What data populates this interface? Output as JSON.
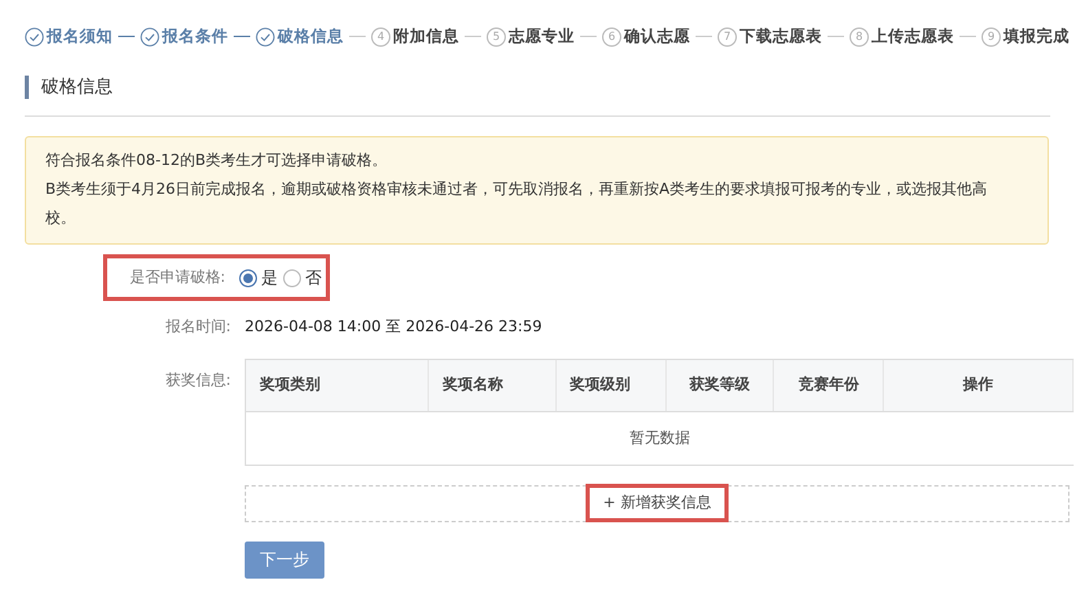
{
  "steps": [
    {
      "label": "报名须知",
      "done": true
    },
    {
      "label": "报名条件",
      "done": true
    },
    {
      "label": "破格信息",
      "done": true
    },
    {
      "number": "4",
      "label": "附加信息",
      "done": false
    },
    {
      "number": "5",
      "label": "志愿专业",
      "done": false
    },
    {
      "number": "6",
      "label": "确认志愿",
      "done": false
    },
    {
      "number": "7",
      "label": "下载志愿表",
      "done": false
    },
    {
      "number": "8",
      "label": "上传志愿表",
      "done": false
    },
    {
      "number": "9",
      "label": "填报完成",
      "done": false
    }
  ],
  "section_title": "破格信息",
  "notice": [
    "符合报名条件08-12的B类考生才可选择申请破格。",
    "B类考生须于4月26日前完成报名，逾期或破格资格审核未通过者，可先取消报名，再重新按A类考生的要求填报可报考的专业，或选报其他高校。"
  ],
  "apply_field": {
    "label": "是否申请破格:",
    "highlighted": true,
    "options": [
      {
        "label": "是",
        "selected": true
      },
      {
        "label": "否",
        "selected": false
      }
    ]
  },
  "time_field": {
    "label": "报名时间:",
    "value": "2026-04-08 14:00 至 2026-04-26 23:59"
  },
  "awards": {
    "label": "获奖信息:",
    "columns": [
      "奖项类别",
      "奖项名称",
      "奖项级别",
      "获奖等级",
      "竞赛年份",
      "操作"
    ],
    "empty_text": "暂无数据"
  },
  "add_button": {
    "label": "+ 新增获奖信息",
    "highlighted": true
  },
  "next_button": {
    "label": "下一步"
  }
}
